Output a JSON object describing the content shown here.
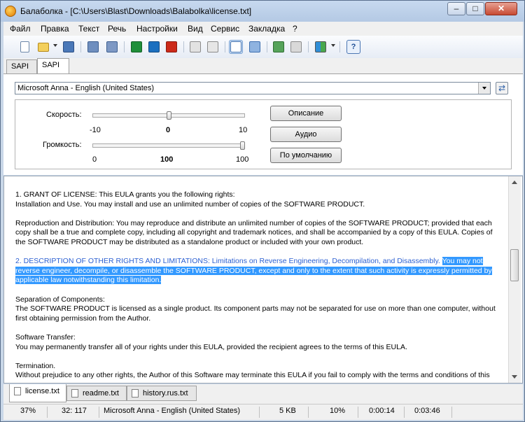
{
  "window": {
    "title": "Балаболка - [C:\\Users\\Blast\\Downloads\\Balabolka\\license.txt]"
  },
  "window_controls": {
    "minimize": "–",
    "maximize": "□",
    "close": "✕"
  },
  "menu": [
    "Файл",
    "Правка",
    "Текст",
    "Речь",
    "Настройки",
    "Вид",
    "Сервис",
    "Закладка",
    "?"
  ],
  "toolbar": {
    "icons": [
      "new-document-icon",
      "open-folder-icon",
      "save-icon",
      "audio-file-icon",
      "speech-file-icon",
      "play-icon",
      "pause-icon",
      "stop-icon",
      "split-icon",
      "copy-icon",
      "text-mode-icon",
      "dictionary-icon",
      "prev-icon",
      "next-icon",
      "voice-icon",
      "help-icon"
    ],
    "play_color": "#1f8f3a",
    "pause_color": "#1b6fbf",
    "stop_color": "#cc2a1a",
    "help_glyph": "?"
  },
  "sapi_tabs": [
    {
      "label": "SAPI 4"
    },
    {
      "label": "SAPI 5"
    }
  ],
  "voice": {
    "selected": "Microsoft Anna - English (United States)",
    "refresh_glyph": "⇄"
  },
  "settings": {
    "rate": {
      "label": "Скорость:",
      "min": "-10",
      "mid": "0",
      "max": "10",
      "value": 0,
      "range": [
        -10,
        10
      ]
    },
    "volume": {
      "label": "Громкость:",
      "min": "0",
      "mid": "100",
      "max": "100",
      "value": 100,
      "range": [
        0,
        100
      ]
    },
    "buttons": {
      "description": "Описание",
      "audio": "Аудио",
      "default": "По умолчанию"
    }
  },
  "document": {
    "p1_line1": "1. GRANT OF LICENSE: This EULA grants you the following rights:",
    "p1_line2": "Installation and Use. You may install and use an unlimited number of copies of the SOFTWARE PRODUCT.",
    "p2": "Reproduction and Distribution: You may reproduce and distribute an unlimited number of copies of the SOFTWARE PRODUCT; provided that each copy shall be a true and complete copy, including all copyright and trademark notices, and shall be accompanied by a copy of this EULA. Copies of the SOFTWARE PRODUCT may be distributed as a standalone product or included with your own product.",
    "p3_link": "2. DESCRIPTION OF OTHER RIGHTS AND LIMITATIONS: Limitations on Reverse Engineering, Decompilation, and Disassembly.",
    "p3_selected": "You may not reverse engineer, decompile, or disassemble the SOFTWARE PRODUCT, except and only to the extent that such activity is expressly permitted by applicable law notwithstanding this limitation.",
    "p4_line1": "Separation of Components:",
    "p4_line2": "The SOFTWARE PRODUCT is licensed as a single product. Its component parts may not be separated for use on more than one computer, without first obtaining permission from the Author.",
    "p5_line1": "Software Transfer:",
    "p5_line2": "You may permanently transfer all of your rights under this EULA, provided the recipient agrees to the terms of this EULA.",
    "p6_line1": "Termination.",
    "p6_line2": "Without prejudice to any other rights, the Author of this Software may terminate this EULA if you fail to comply with the terms and conditions of this"
  },
  "document_tabs": [
    {
      "label": "license.txt"
    },
    {
      "label": "readme.txt"
    },
    {
      "label": "history.rus.txt"
    }
  ],
  "status": {
    "zoom": "37%",
    "position": "32: 117",
    "voice": "Microsoft Anna - English (United States)",
    "size": "5 KB",
    "progress": "10%",
    "elapsed": "0:00:14",
    "total": "0:03:46"
  }
}
